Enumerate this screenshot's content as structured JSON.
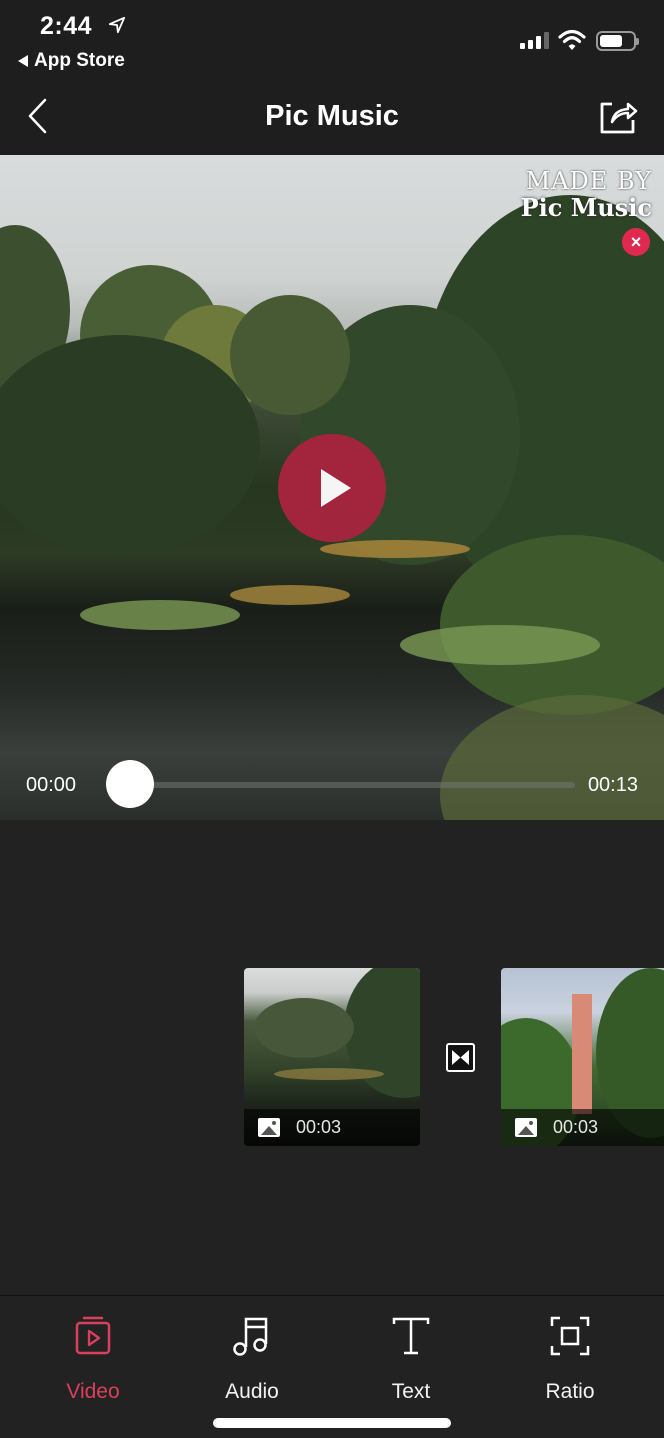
{
  "status_bar": {
    "time": "2:44",
    "back_app_label": "App Store",
    "battery_level": 0.68
  },
  "nav": {
    "title": "Pic Music",
    "back_icon": "chevron-left-icon",
    "share_icon": "share-icon"
  },
  "preview": {
    "watermark_line1": "MADE BY",
    "watermark_line2": "Pic Music",
    "watermark_close": "×",
    "current_time": "00:00",
    "total_time": "00:13",
    "progress": 0,
    "colors": {
      "accent": "#e0294f",
      "play_button": "#a9243f"
    }
  },
  "timeline": {
    "clips": [
      {
        "type": "image",
        "duration": "00:03"
      },
      {
        "type": "image",
        "duration": "00:03"
      }
    ]
  },
  "tabbar": {
    "tabs": [
      {
        "label": "Video",
        "icon": "video-icon",
        "active": true
      },
      {
        "label": "Audio",
        "icon": "music-note-icon",
        "active": false
      },
      {
        "label": "Text",
        "icon": "text-icon",
        "active": false
      },
      {
        "label": "Ratio",
        "icon": "ratio-icon",
        "active": false
      }
    ],
    "active_color": "#d9405d"
  }
}
